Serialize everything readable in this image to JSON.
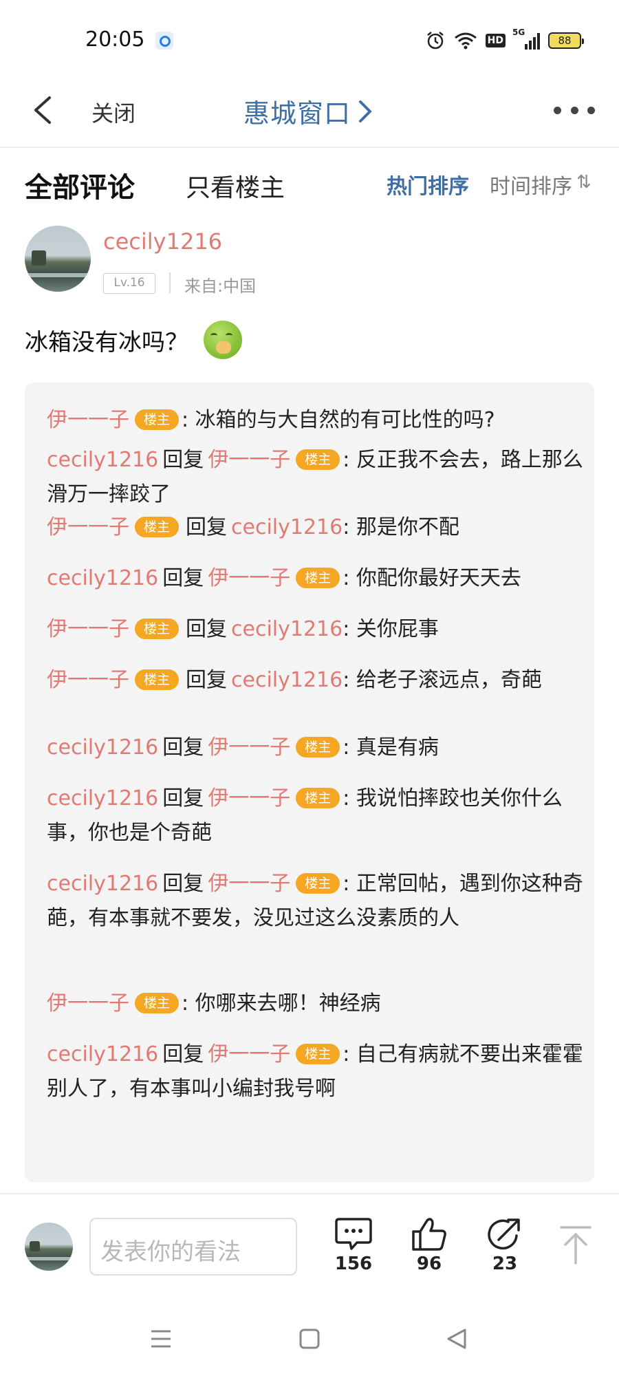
{
  "status_bar": {
    "time": "20:05",
    "network": "5G",
    "hd": "HD",
    "battery": "88"
  },
  "nav": {
    "close_label": "关闭",
    "title": "惠城窗口"
  },
  "tabs": {
    "all_comments": "全部评论",
    "owner_only": "只看楼主",
    "sort_hot": "热门排序",
    "sort_time": "时间排序"
  },
  "post": {
    "username": "cecily1216",
    "level": "Lv.16",
    "origin": "来自:中国",
    "content": "冰箱没有冰吗？"
  },
  "replies": {
    "reply_word": "回复",
    "owner_badge": "楼主",
    "items": [
      {
        "user": "伊一一子",
        "user_owner": true,
        "target": "",
        "target_owner": false,
        "text": ": 冰箱的与大自然的有可比性的吗?"
      },
      {
        "user": "cecily1216",
        "user_owner": false,
        "target": "伊一一子",
        "target_owner": true,
        "text": ": 反正我不会去，路上那么滑万一摔跤了"
      },
      {
        "user": "伊一一子",
        "user_owner": true,
        "target": "cecily1216",
        "target_owner": false,
        "text": ": 那是你不配"
      },
      {
        "user": "cecily1216",
        "user_owner": false,
        "target": "伊一一子",
        "target_owner": true,
        "text": ": 你配你最好天天去"
      },
      {
        "user": "伊一一子",
        "user_owner": true,
        "target": "cecily1216",
        "target_owner": false,
        "text": ": 关你屁事"
      },
      {
        "user": "伊一一子",
        "user_owner": true,
        "target": "cecily1216",
        "target_owner": false,
        "text": ": 给老子滚远点，奇葩"
      },
      {
        "user": "cecily1216",
        "user_owner": false,
        "target": "伊一一子",
        "target_owner": true,
        "text": ": 真是有病"
      },
      {
        "user": "cecily1216",
        "user_owner": false,
        "target": "伊一一子",
        "target_owner": true,
        "text": ": 我说怕摔跤也关你什么事，你也是个奇葩"
      },
      {
        "user": "cecily1216",
        "user_owner": false,
        "target": "伊一一子",
        "target_owner": true,
        "text": ": 正常回帖，遇到你这种奇葩，有本事就不要发，没见过这么没素质的人"
      },
      {
        "user": "伊一一子",
        "user_owner": true,
        "target": "",
        "target_owner": false,
        "text": ": 你哪来去哪！神经病"
      },
      {
        "user": "cecily1216",
        "user_owner": false,
        "target": "伊一一子",
        "target_owner": true,
        "text": ": 自己有病就不要出来霍霍别人了，有本事叫小编封我号啊"
      }
    ]
  },
  "bottom_bar": {
    "input_placeholder": "发表你的看法",
    "comments_count": "156",
    "likes_count": "96",
    "shares_count": "23"
  }
}
